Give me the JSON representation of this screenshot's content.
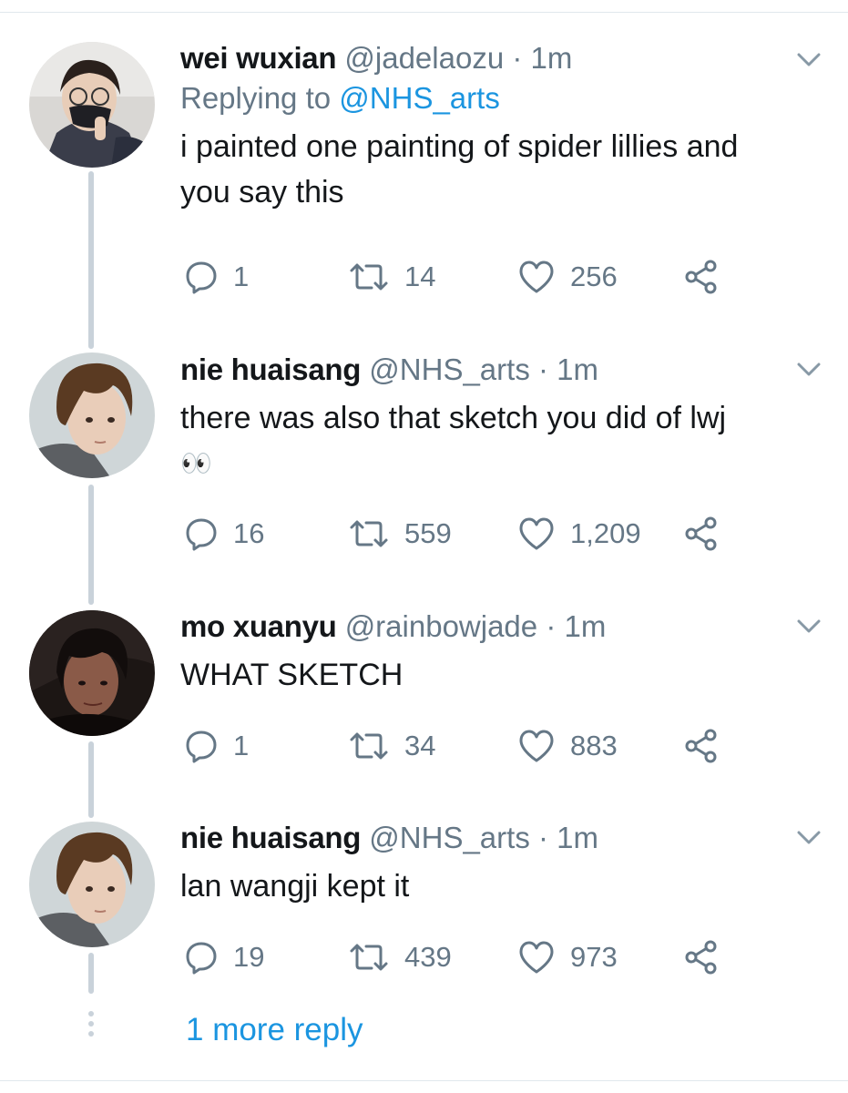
{
  "tweets": [
    {
      "name": "wei wuxian",
      "handle": "@jadelaozu",
      "time": "1m",
      "replying_prefix": "Replying to",
      "replying_to": "@NHS_arts",
      "text_lines": [
        "i painted one painting of spider lillies and",
        "you say this"
      ],
      "replies": "1",
      "retweets": "14",
      "likes": "256"
    },
    {
      "name": "nie huaisang",
      "handle": "@NHS_arts",
      "time": "1m",
      "text_lines": [
        "there was also that sketch you did of lwj",
        "👀"
      ],
      "replies": "16",
      "retweets": "559",
      "likes": "1,209"
    },
    {
      "name": "mo xuanyu",
      "handle": "@rainbowjade",
      "time": "1m",
      "text_lines": [
        "WHAT SKETCH"
      ],
      "replies": "1",
      "retweets": "34",
      "likes": "883"
    },
    {
      "name": "nie huaisang",
      "handle": "@NHS_arts",
      "time": "1m",
      "text_lines": [
        "lan wangji kept it"
      ],
      "replies": "19",
      "retweets": "439",
      "likes": "973"
    }
  ],
  "more_replies": "1 more reply",
  "separator": "·",
  "icons": {
    "reply": "reply-icon",
    "retweet": "retweet-icon",
    "like": "heart-icon",
    "share": "share-icon",
    "menu": "chevron-down-icon"
  },
  "colors": {
    "text": "#14171a",
    "secondary": "#657786",
    "link": "#1b95e0",
    "thread_line": "#c9d2da"
  }
}
